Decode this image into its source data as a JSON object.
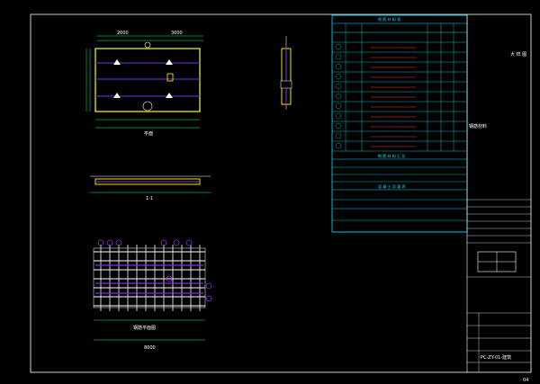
{
  "drawing": {
    "title_block": {
      "drawing_number": "PC-ZY-01-建筑",
      "sheet": "04",
      "vertical_note": "大 样 图"
    },
    "table_headers": {
      "main_table": "钢 筋 材 料 表",
      "summary_table": "钢 筋 材 料 汇 总",
      "concrete_table": "混 凝 土 用 量 表"
    },
    "side_note": "钢筋材料",
    "elevation_label": "1-1",
    "plan_label": "平面",
    "plan_top_dims": [
      "2000",
      "3000"
    ],
    "elevation_dim": "8000",
    "rebar_plan_dim": "钢筋平面图",
    "rebar_rows": [
      "1",
      "2",
      "3",
      "4",
      "5",
      "6",
      "7",
      "8",
      "9",
      "10",
      "11",
      "12"
    ],
    "colors": {
      "background": "#000000",
      "outline": "#ffffff",
      "table": "#00e5ff",
      "slab": "#ffff00",
      "rebar": "#8a2be2",
      "annotation": "#ff3030",
      "dimension": "#00ff66"
    }
  }
}
